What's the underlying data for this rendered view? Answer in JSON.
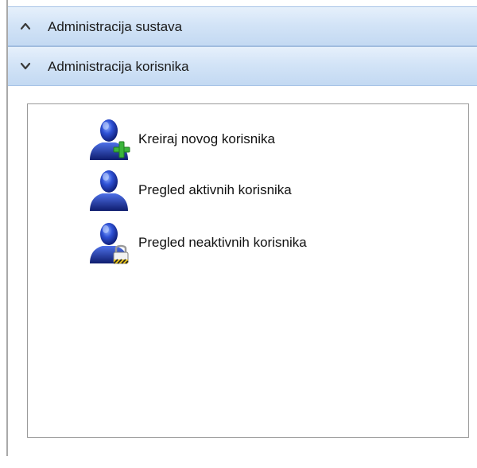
{
  "accordion": {
    "sections": [
      {
        "label": "Administracija sustava",
        "state": "collapsed",
        "icon": "chevron-up-icon"
      },
      {
        "label": "Administracija korisnika",
        "state": "expanded",
        "icon": "chevron-down-icon"
      }
    ]
  },
  "user_menu": {
    "items": [
      {
        "label": "Kreiraj novog korisnika",
        "icon": "user-add-icon"
      },
      {
        "label": "Pregled aktivnih korisnika",
        "icon": "user-icon"
      },
      {
        "label": "Pregled neaktivnih korisnika",
        "icon": "user-locked-icon"
      }
    ]
  },
  "colors": {
    "header_gradient_top": "#e6f0fb",
    "header_gradient_bottom": "#c3d9f2",
    "icon_blue": "#1f3fb8",
    "add_green": "#3bb53b"
  }
}
